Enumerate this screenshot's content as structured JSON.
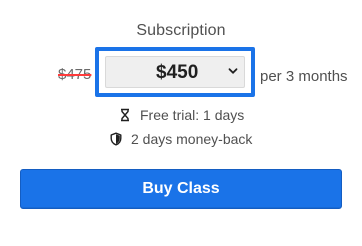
{
  "subscription": {
    "title": "Subscription",
    "original_price": "$475",
    "selected_price": "$450",
    "period_suffix": "per 3 months",
    "free_trial": "Free trial: 1 days",
    "money_back": "2 days money-back",
    "buy_button_label": "Buy Class"
  },
  "icons": {
    "hourglass": "hourglass-icon",
    "shield": "shield-icon",
    "chevron": "chevron-down-icon"
  },
  "colors": {
    "accent": "#1a73e8",
    "strikethrough": "#ff3b3b",
    "select_background": "#efefef"
  }
}
